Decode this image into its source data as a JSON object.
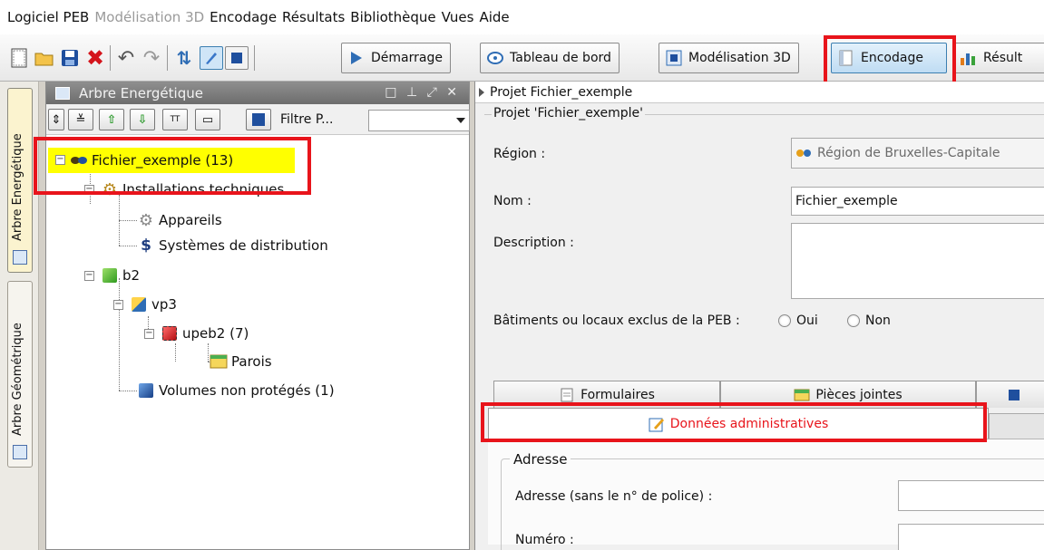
{
  "menu": {
    "items": [
      {
        "label": "Logiciel PEB",
        "enabled": true
      },
      {
        "label": "Modélisation 3D",
        "enabled": false
      },
      {
        "label": "Encodage",
        "enabled": true
      },
      {
        "label": "Résultats",
        "enabled": true
      },
      {
        "label": "Bibliothèque",
        "enabled": true
      },
      {
        "label": "Vues",
        "enabled": true
      },
      {
        "label": "Aide",
        "enabled": true
      }
    ]
  },
  "toolbar": {
    "demarrage_label": "Démarrage",
    "tableau_label": "Tableau de bord",
    "modelisation_label": "Modélisation 3D",
    "encodage_label": "Encodage",
    "resultats_label": "Résult"
  },
  "vertical_tabs": {
    "arbre_energetique": "Arbre Energétique",
    "arbre_geometrique": "Arbre Géométrique"
  },
  "tree_panel": {
    "title": "Arbre Energétique",
    "filter_label": "Filtre P...",
    "filter_value": "",
    "nodes": {
      "root": "Fichier_exemple (13)",
      "installations": "Installations techniques",
      "appareils": "Appareils",
      "systemes": "Systèmes de distribution",
      "b2": "b2",
      "vp3": "vp3",
      "upeb2": "upeb2 (7)",
      "parois": "Parois",
      "volumes": "Volumes non protégés (1)"
    }
  },
  "project": {
    "breadcrumb": "Projet Fichier_exemple",
    "group_title": "Projet 'Fichier_exemple'",
    "region_label": "Région :",
    "region_value": "Région de Bruxelles-Capitale",
    "nom_label": "Nom :",
    "nom_value": "Fichier_exemple",
    "description_label": "Description :",
    "description_value": "",
    "exclus_label": "Bâtiments ou locaux exclus de la PEB :",
    "oui_label": "Oui",
    "non_label": "Non"
  },
  "tabs": {
    "formulaires": "Formulaires",
    "pieces": "Pièces jointes",
    "donnees": "Données administratives"
  },
  "adresse": {
    "title": "Adresse",
    "adresse_label": "Adresse (sans le n° de police) :",
    "adresse_value": "",
    "numero_label": "Numéro :",
    "numero_value": ""
  },
  "colors": {
    "highlight": "#e8141b",
    "tree_highlight": "#ffff00",
    "accent_blue": "#2f6db5"
  }
}
